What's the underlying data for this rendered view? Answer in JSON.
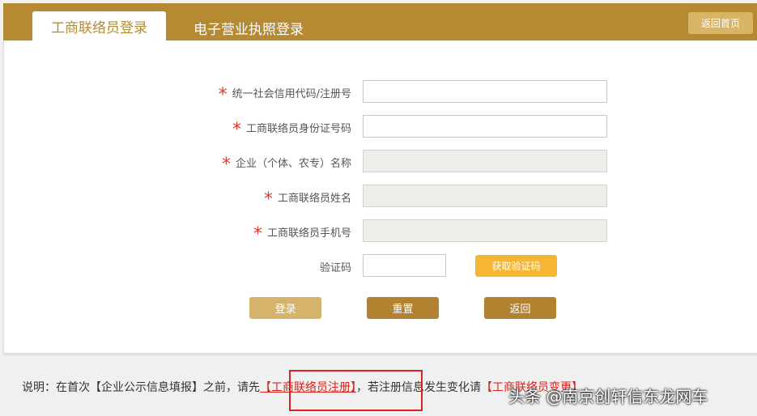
{
  "tabs": {
    "active": "工商联络员登录",
    "inactive": "电子营业执照登录"
  },
  "header": {
    "home_button": "返回首页"
  },
  "form": {
    "fields": [
      {
        "label": "统一社会信用代码/注册号",
        "required": "*",
        "value": ""
      },
      {
        "label": "工商联络员身份证号码",
        "required": "*",
        "value": ""
      },
      {
        "label": "企业（个体、农专）名称",
        "required": "*",
        "value": ""
      },
      {
        "label": "工商联络员姓名",
        "required": "*",
        "value": ""
      },
      {
        "label": "工商联络员手机号",
        "required": "*",
        "value": ""
      }
    ],
    "captcha_label": "验证码",
    "get_code_button": "获取验证码",
    "buttons": {
      "login": "登录",
      "reset": "重置",
      "back": "返回"
    }
  },
  "note": {
    "prefix": "说明：在首次【企业公示信息填报】之前，请先",
    "register_link": "【工商联络员注册】",
    "middle": "，若注册信息发生变化请",
    "change_link": "【工商联络员变更】"
  },
  "watermark": "头条 @南京创轩信东龙网车",
  "colors": {
    "brand": "#b58a32",
    "accent": "#f5b535",
    "required": "#e03a2c",
    "link": "#d6231e"
  }
}
